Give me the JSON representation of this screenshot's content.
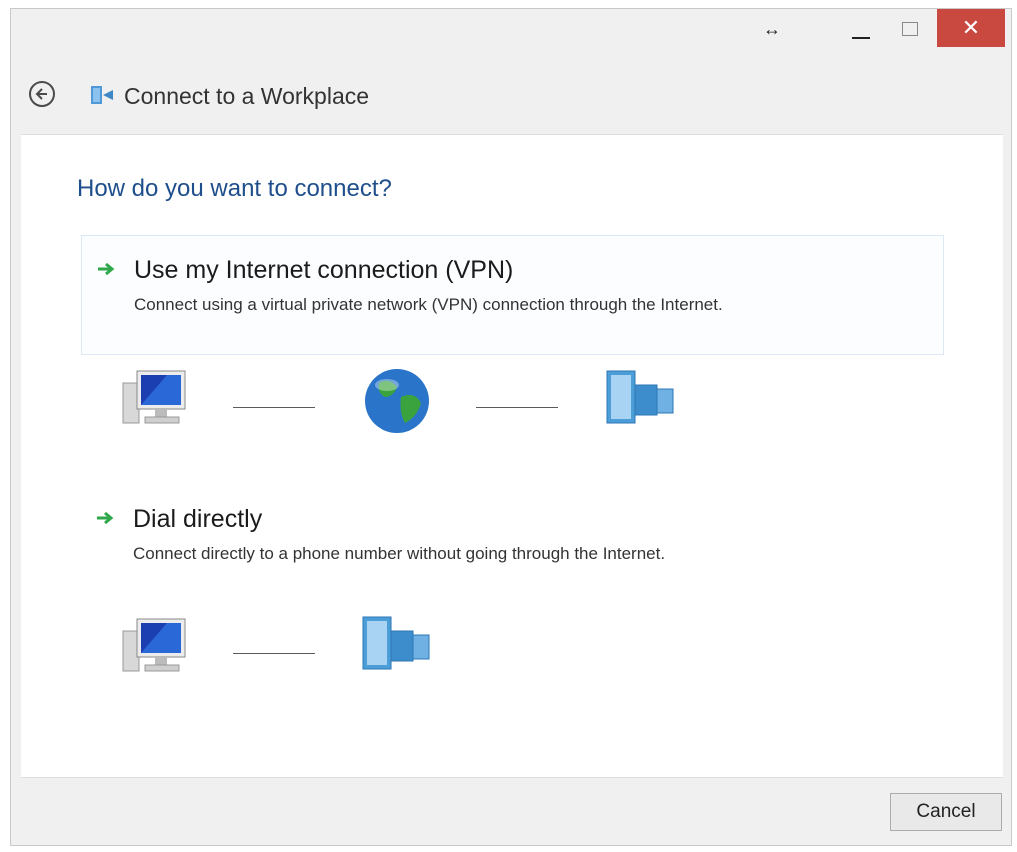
{
  "window": {
    "snap_glyph": "↔",
    "close_glyph": "✕"
  },
  "nav": {
    "title": "Connect to a Workplace",
    "back_icon": "back-arrow-icon",
    "app_icon": "workplace-icon"
  },
  "main": {
    "heading": "How do you want to connect?",
    "options": [
      {
        "title": "Use my Internet connection (VPN)",
        "description": "Connect using a virtual private network (VPN) connection through the Internet."
      },
      {
        "title": "Dial directly",
        "description": "Connect directly to a phone number without going through the Internet."
      }
    ]
  },
  "footer": {
    "cancel_label": "Cancel"
  },
  "colors": {
    "heading": "#1e4e8c",
    "arrow": "#2ea84a",
    "close": "#c9483f"
  }
}
